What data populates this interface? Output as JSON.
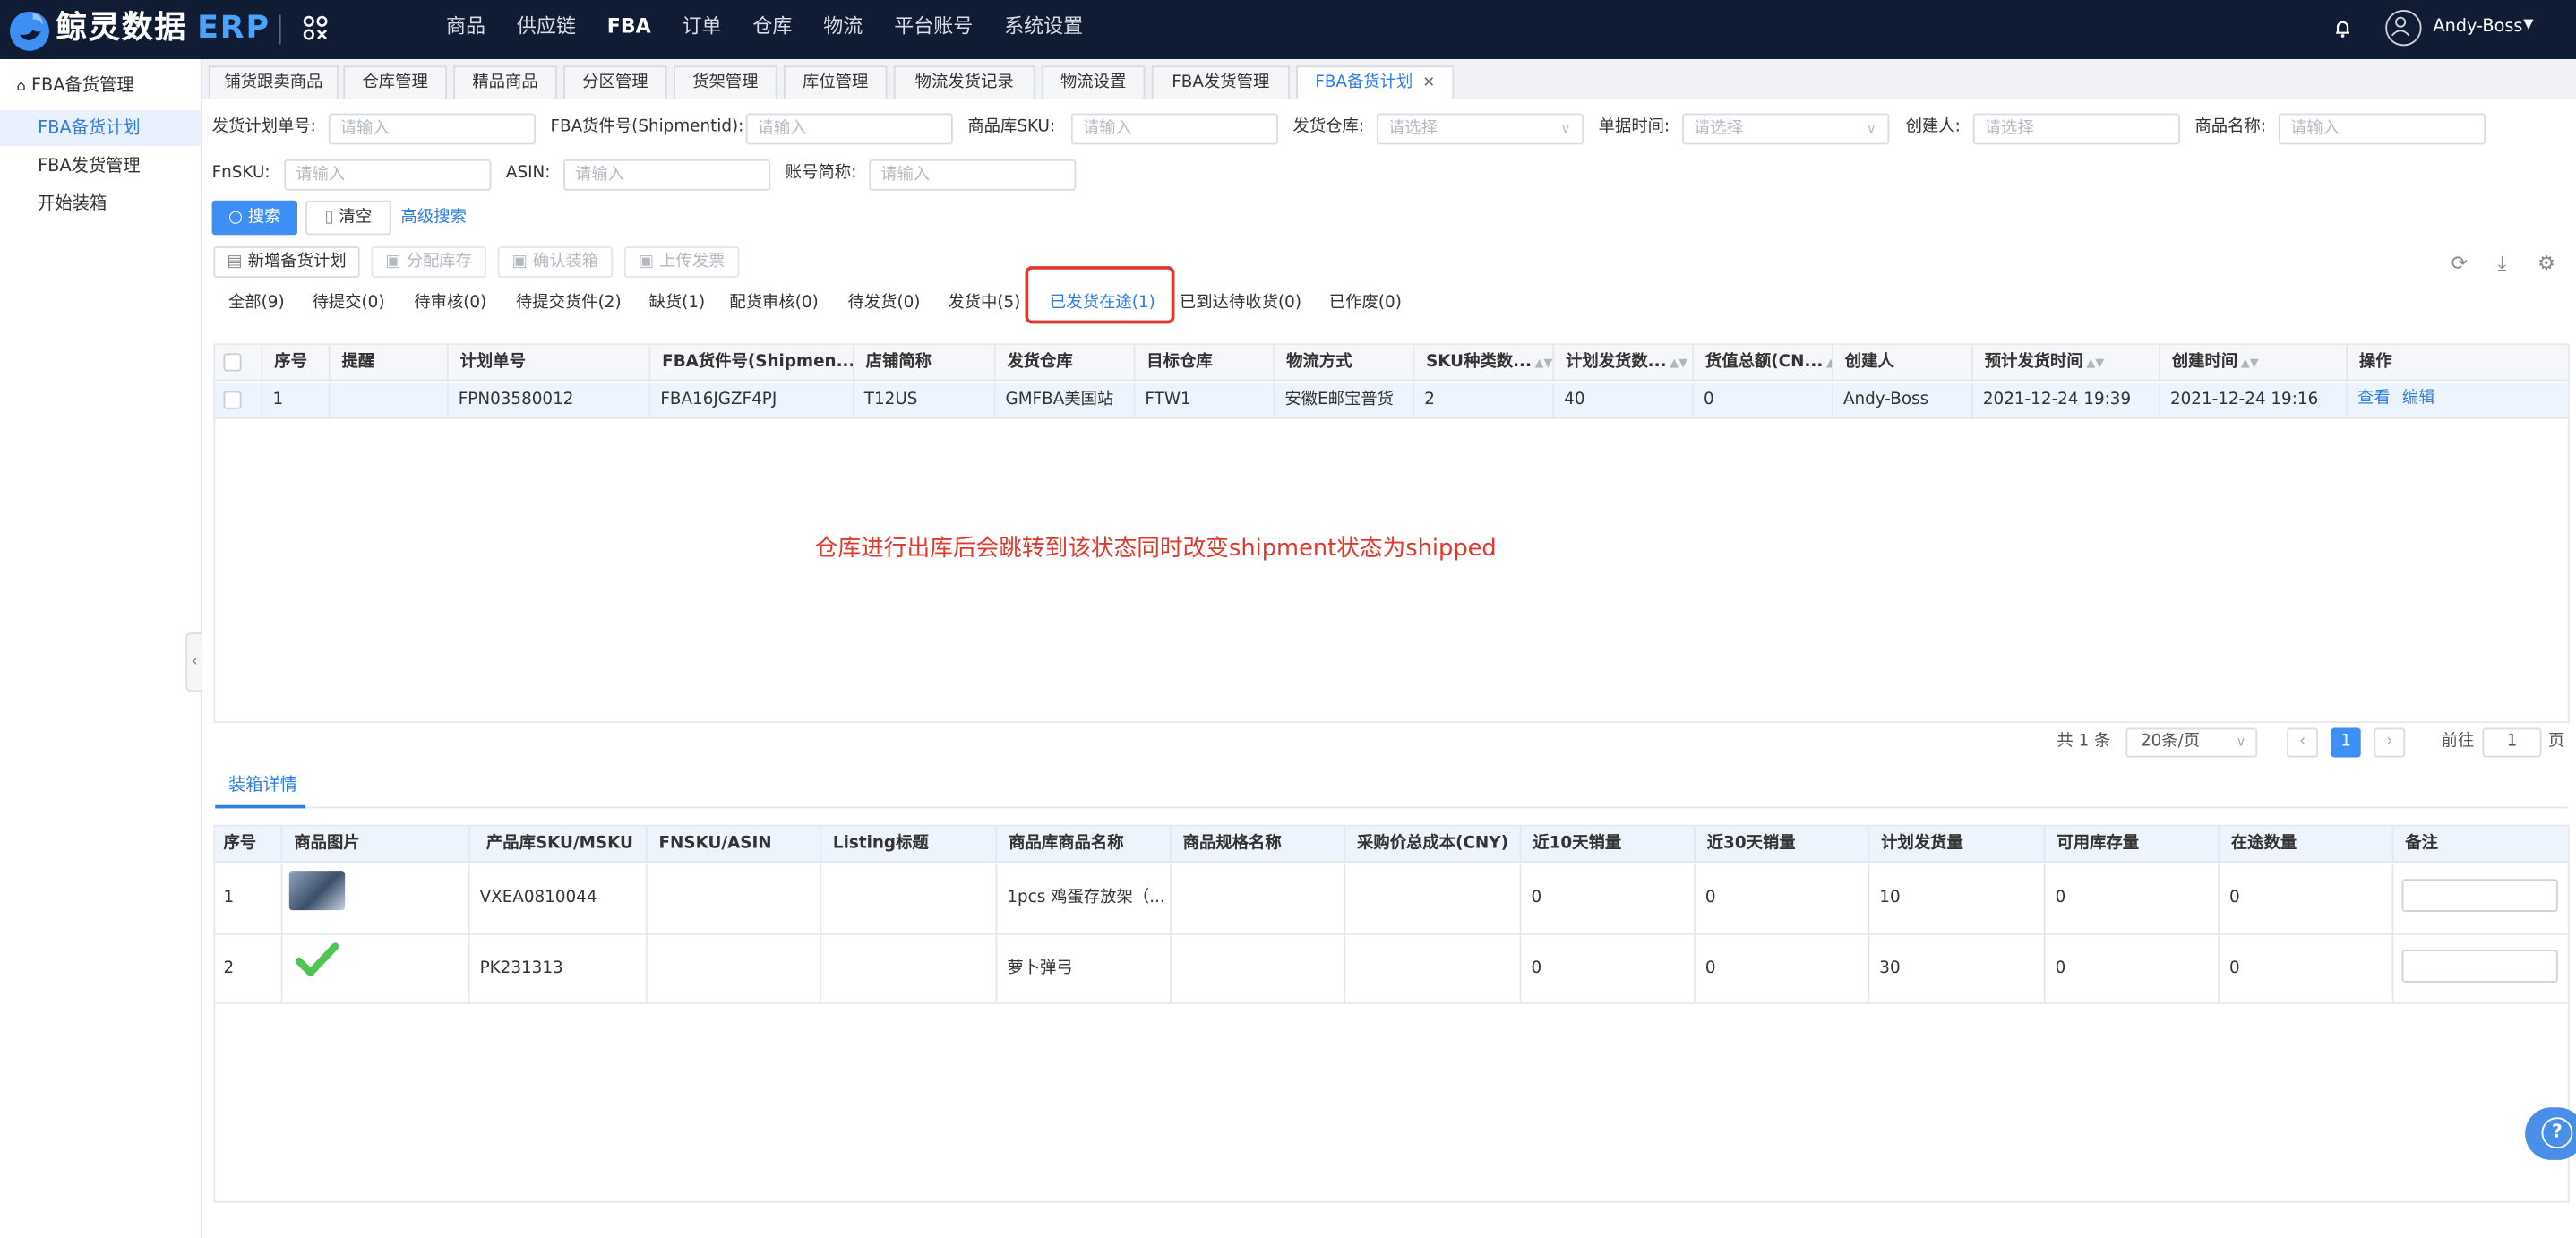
{
  "brand": {
    "name": "鲸灵数据",
    "suffix": "ERP"
  },
  "topnav": [
    "商品",
    "供应链",
    "FBA",
    "订单",
    "仓库",
    "物流",
    "平台账号",
    "系统设置"
  ],
  "user": {
    "name": "Andy-Boss"
  },
  "sidebar": {
    "title": "FBA备货管理",
    "items": [
      "FBA备货计划",
      "FBA发货管理",
      "开始装箱"
    ]
  },
  "page_tabs": [
    "铺货跟卖商品",
    "仓库管理",
    "精品商品",
    "分区管理",
    "货架管理",
    "库位管理",
    "物流发货记录",
    "物流设置",
    "FBA发货管理",
    "FBA备货计划"
  ],
  "filters": {
    "plan_no": {
      "label": "发货计划单号:",
      "placeholder": "请输入"
    },
    "shipment": {
      "label": "FBA货件号(Shipmentid):",
      "placeholder": "请输入"
    },
    "sku": {
      "label": "商品库SKU:",
      "placeholder": "请输入"
    },
    "warehouse": {
      "label": "发货仓库:",
      "placeholder": "请选择"
    },
    "date": {
      "label": "单据时间:",
      "placeholder": "请选择"
    },
    "creator": {
      "label": "创建人:",
      "placeholder": "请选择"
    },
    "product_name": {
      "label": "商品名称:",
      "placeholder": "请输入"
    },
    "fnsku": {
      "label": "FnSKU:",
      "placeholder": "请输入"
    },
    "asin": {
      "label": "ASIN:",
      "placeholder": "请输入"
    },
    "account": {
      "label": "账号简称:",
      "placeholder": "请输入"
    }
  },
  "actions": {
    "search": "搜索",
    "clear": "清空",
    "advanced": "高级搜索"
  },
  "toolbar": {
    "new_plan": "新增备货计划",
    "allocate": "分配库存",
    "confirm_box": "确认装箱",
    "upload": "上传发票"
  },
  "status_tabs": [
    "全部(9)",
    "待提交(0)",
    "待审核(0)",
    "待提交货件(2)",
    "缺货(1)",
    "配货审核(0)",
    "待发货(0)",
    "发货中(5)",
    "已发货在途(1)",
    "已到达待收货(0)",
    "已作废(0)"
  ],
  "table": {
    "headers": [
      "序号",
      "提醒",
      "计划单号",
      "FBA货件号(Shipmen...",
      "店铺简称",
      "发货仓库",
      "目标仓库",
      "物流方式",
      "SKU种类数...",
      "计划发货数...",
      "货值总额(CN...",
      "创建人",
      "预计发货时间",
      "创建时间",
      "操作"
    ],
    "rows": [
      {
        "no": "1",
        "remind": "",
        "plan_no": "FPN03580012",
        "shipment": "FBA16JGZF4PJ",
        "shop": "T12US",
        "from_wh": "GMFBA美国站",
        "to_wh": "FTW1",
        "logistics": "安徽E邮宝普货",
        "sku_kinds": "2",
        "plan_qty": "40",
        "value": "0",
        "creator": "Andy-Boss",
        "eta": "2021-12-24 19:39",
        "created": "2021-12-24 19:16",
        "op_view": "查看",
        "op_edit": "编辑"
      }
    ]
  },
  "annotation": "仓库进行出库后会跳转到该状态同时改变shipment状态为shipped",
  "pagination": {
    "total": "共 1 条",
    "page_size": "20条/页",
    "current": "1",
    "goto_label": "前往",
    "goto_value": "1",
    "page_suffix": "页"
  },
  "detail": {
    "tab": "装箱详情",
    "headers": [
      "序号",
      "商品图片",
      "产品库SKU/MSKU",
      "FNSKU/ASIN",
      "Listing标题",
      "商品库商品名称",
      "商品规格名称",
      "采购价总成本(CNY)",
      "近10天销量",
      "近30天销量",
      "计划发货量",
      "可用库存量",
      "在途数量",
      "备注"
    ],
    "rows": [
      {
        "no": "1",
        "sku": "VXEA0810044",
        "fnsku": "",
        "listing": "",
        "name": "1pcs 鸡蛋存放架（...",
        "spec": "",
        "cost": "",
        "s10": "0",
        "s30": "0",
        "plan": "10",
        "avail": "0",
        "transit": "0"
      },
      {
        "no": "2",
        "sku": "PK231313",
        "fnsku": "",
        "listing": "",
        "name": "萝卜弹弓",
        "spec": "",
        "cost": "",
        "s10": "0",
        "s30": "0",
        "plan": "30",
        "avail": "0",
        "transit": "0"
      }
    ]
  },
  "colors": {
    "topbar": "#0f1c33",
    "accent": "#3d8ef5",
    "annotation": "#e0382c",
    "active_bg": "#e8f1fd"
  }
}
